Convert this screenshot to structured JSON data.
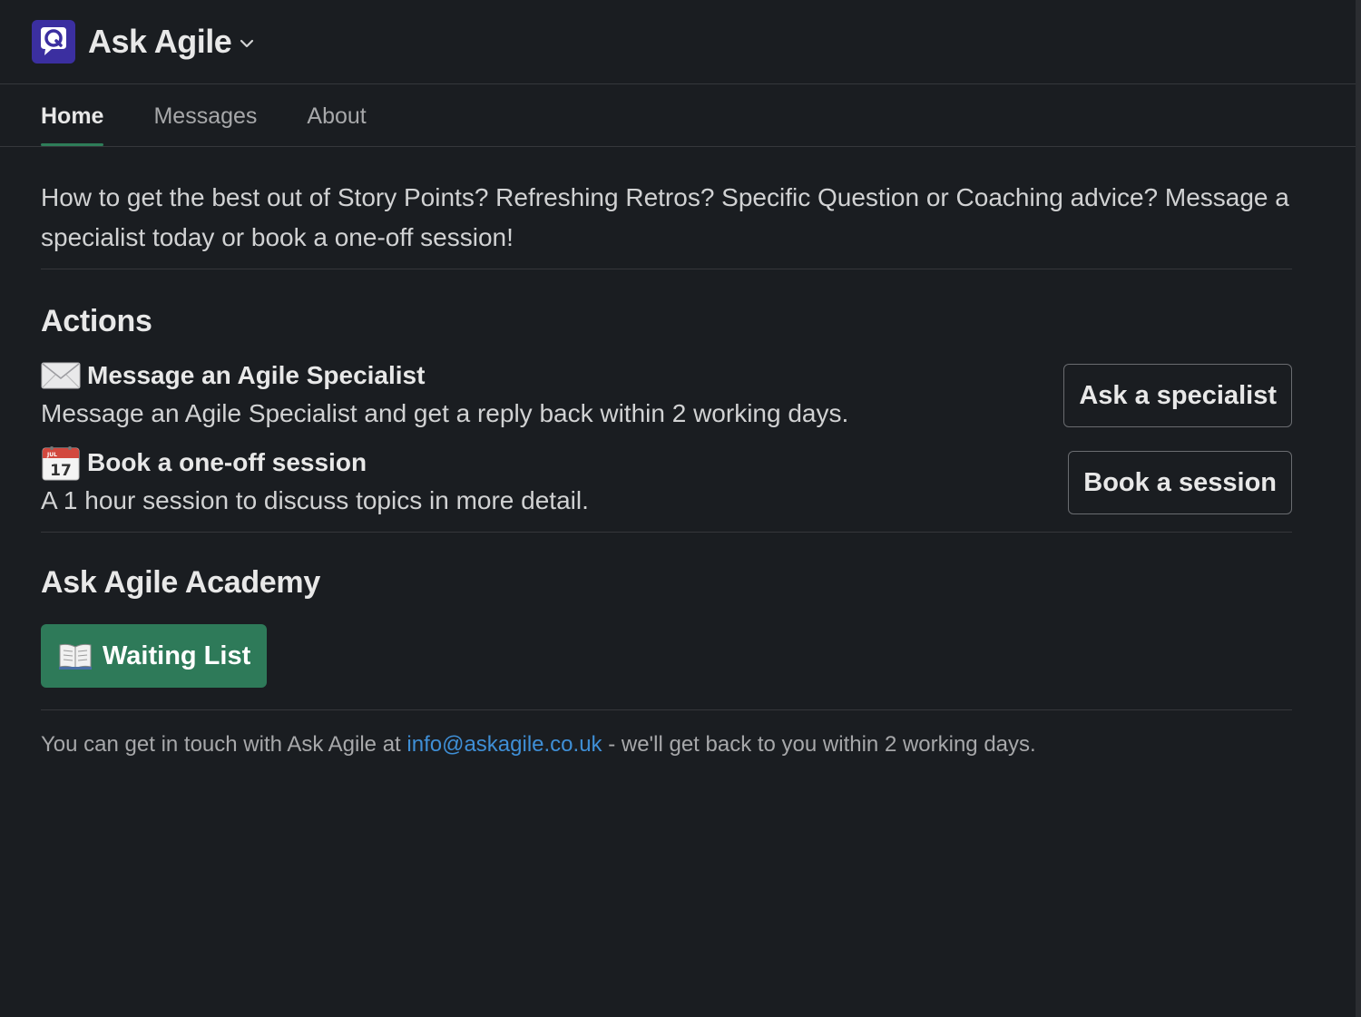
{
  "header": {
    "app_name": "Ask Agile",
    "logo_icon": "ask-agile-logo",
    "menu_icon": "chevron-down-icon"
  },
  "tabs": [
    {
      "label": "Home",
      "active": true
    },
    {
      "label": "Messages",
      "active": false
    },
    {
      "label": "About",
      "active": false
    }
  ],
  "intro": {
    "text": "How to get the best out of Story Points? Refreshing Retros? Specific Question or Coaching advice? Message a specialist today or book a one-off session!"
  },
  "actions": {
    "heading": "Actions",
    "items": [
      {
        "icon": "envelope-icon",
        "title": "Message an Agile Specialist",
        "description": "Message an Agile Specialist and get a reply back within 2 working days.",
        "button_label": "Ask a specialist"
      },
      {
        "icon": "calendar-icon",
        "calendar_month": "JUL",
        "calendar_day": "17",
        "title": "Book a one-off session",
        "description": "A 1 hour session to discuss topics in more detail.",
        "button_label": "Book a session"
      }
    ]
  },
  "academy": {
    "heading": "Ask Agile Academy",
    "button_icon": "open-book-icon",
    "button_label": "Waiting List"
  },
  "footer": {
    "prefix": "You can get in touch with Ask Agile at",
    "email": "info@askagile.co.uk",
    "suffix": "- we'll get back to you within 2 working days."
  },
  "colors": {
    "background": "#1a1d21",
    "accent_green": "#2e7a59",
    "link_blue": "#3f8fd6",
    "logo_purple": "#3b2fa0"
  }
}
